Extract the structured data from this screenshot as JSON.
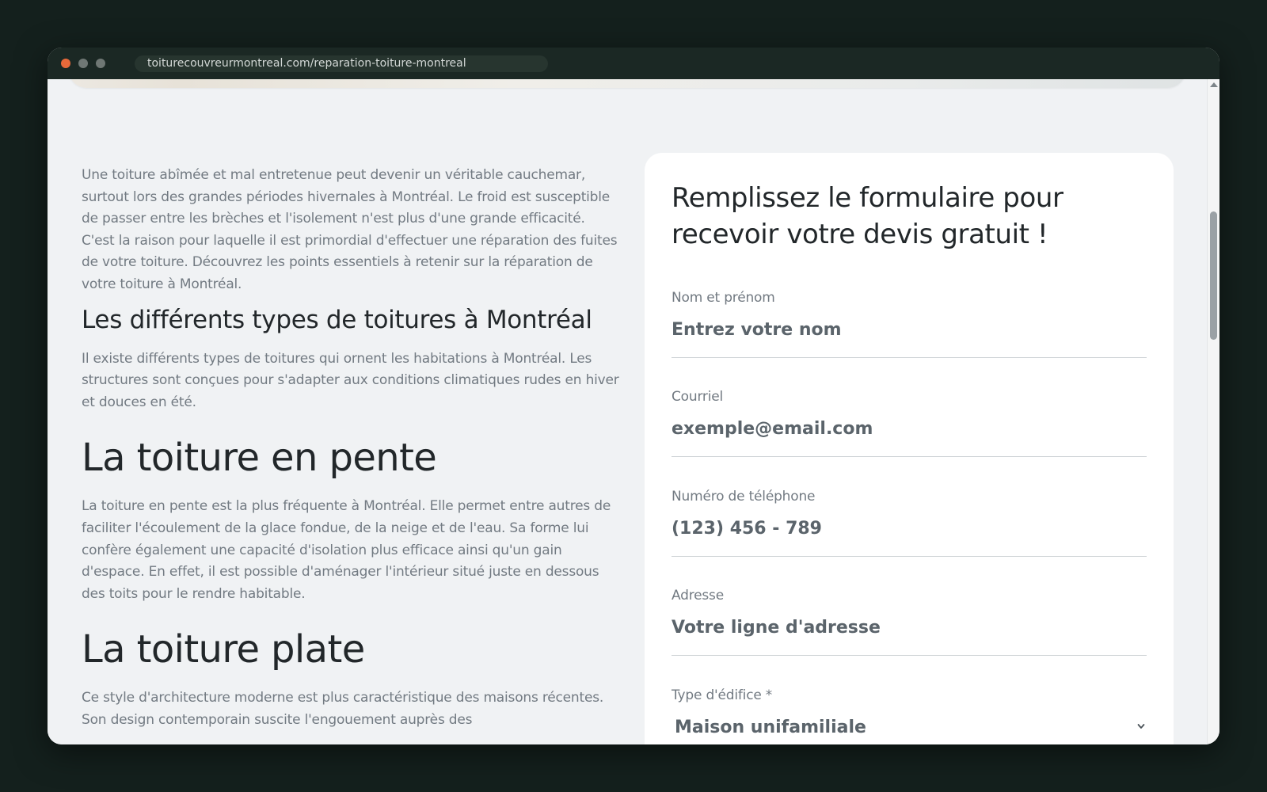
{
  "browser": {
    "url": "toiturecouvreurmontreal.com/reparation-toiture-montreal"
  },
  "article": {
    "intro": "Une toiture abîmée et mal entretenue peut devenir un véritable cauchemar, surtout lors des grandes périodes hivernales à Montréal. Le froid est susceptible de passer entre les brèches et l'isolement n'est plus d'une grande efficacité. C'est la raison pour laquelle il est primordial d'effectuer une réparation des fuites de votre toiture. Découvrez les points essentiels à retenir sur la réparation de votre toiture à Montréal.",
    "section1_heading": "Les différents types de toitures à Montréal",
    "section1_text": "Il existe différents types de toitures qui ornent les habitations à Montréal. Les structures sont conçues pour s'adapter aux conditions climatiques rudes en hiver et douces en été.",
    "section2_heading": "La toiture en pente",
    "section2_text": "La toiture en pente est la plus fréquente à Montréal. Elle permet entre autres de faciliter l'écoulement de la glace fondue, de la neige et de l'eau. Sa forme lui confère également une capacité d'isolation plus efficace ainsi qu'un gain d'espace. En effet, il est possible d'aménager l'intérieur situé juste en dessous des toits pour le rendre habitable.",
    "section3_heading": "La toiture plate",
    "section3_text": "Ce style d'architecture moderne est plus caractéristique des maisons récentes. Son design contemporain suscite l'engouement auprès des"
  },
  "form": {
    "title": "Remplissez le formulaire pour recevoir votre devis gratuit !",
    "name_label": "Nom et prénom",
    "name_placeholder": "Entrez votre nom",
    "email_label": "Courriel",
    "email_placeholder": "exemple@email.com",
    "phone_label": "Numéro de téléphone",
    "phone_placeholder": "(123) 456 - 789",
    "address_label": "Adresse",
    "address_placeholder": "Votre ligne d'adresse",
    "building_label": "Type d'édifice *",
    "building_value": "Maison unifamiliale"
  },
  "colors": {
    "background": "#14201d",
    "window_dot_close": "#e8693a",
    "page_background": "#f0f2f4",
    "card_background": "#ffffff"
  }
}
